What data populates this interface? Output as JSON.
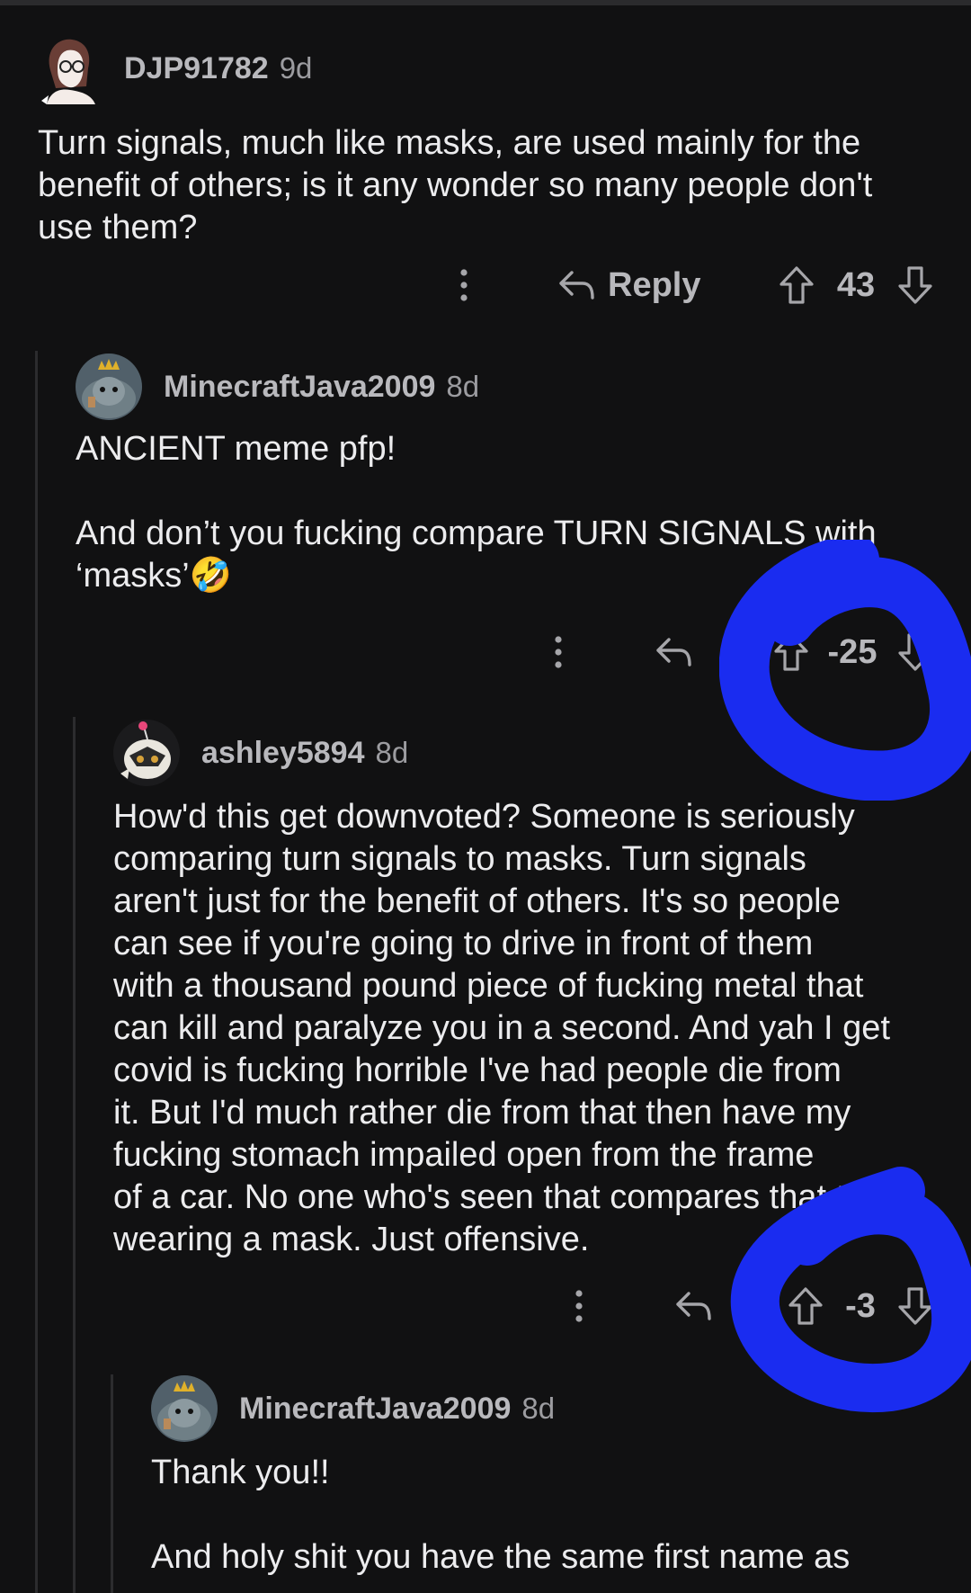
{
  "comments": [
    {
      "username": "DJP91782",
      "age": "9d",
      "body": "Turn signals, much like masks, are used mainly for the\nbenefit of others; is it any wonder so many people don't\nuse them?",
      "reply_label": "Reply",
      "score": "43"
    },
    {
      "username": "MinecraftJava2009",
      "age": "8d",
      "body": "ANCIENT meme pfp!\n\nAnd don’t you fucking compare TURN SIGNALS with\n‘masks’🤣",
      "score": "-25"
    },
    {
      "username": "ashley5894",
      "age": "8d",
      "body": "How'd this get downvoted? Someone is seriously\ncomparing turn signals to masks. Turn signals\naren't just for the benefit of others. It's so people\ncan see if you're going to drive in front of them\nwith a thousand pound piece of fucking metal that\ncan kill and paralyze you in a second. And yah I get\ncovid is fucking horrible I've had people die from\nit. But I'd much rather die from that then have my\nfucking stomach impailed open from the frame\nof a car. No one who's seen that compares that to\nwearing a mask. Just offensive.",
      "score": "-3"
    },
    {
      "username": "MinecraftJava2009",
      "age": "8d",
      "body": "Thank you!!\n\nAnd holy shit you have the same first name as"
    }
  ],
  "icons": {
    "more": "more-vertical-icon",
    "reply": "reply-arrow-icon",
    "upvote": "upvote-arrow-icon",
    "downvote": "downvote-arrow-icon"
  },
  "colors": {
    "background": "#111112",
    "annotation": "#1a2cf0"
  }
}
